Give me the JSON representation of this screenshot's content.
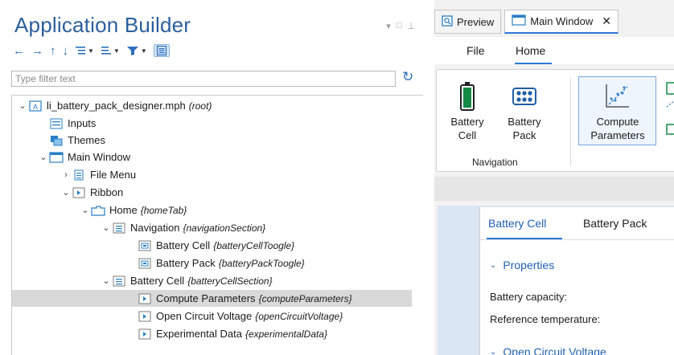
{
  "left_panel": {
    "title": "Application Builder",
    "filter_placeholder": "Type filter text",
    "tree": [
      {
        "label": "li_battery_pack_designer.mph",
        "annotation": "(root)"
      },
      {
        "label": "Inputs",
        "annotation": ""
      },
      {
        "label": "Themes",
        "annotation": ""
      },
      {
        "label": "Main Window",
        "annotation": ""
      },
      {
        "label": "File Menu",
        "annotation": ""
      },
      {
        "label": "Ribbon",
        "annotation": ""
      },
      {
        "label": "Home",
        "annotation": "{homeTab}"
      },
      {
        "label": "Navigation",
        "annotation": "{navigationSection}"
      },
      {
        "label": "Battery Cell",
        "annotation": "{batteryCellToogle}"
      },
      {
        "label": "Battery Pack",
        "annotation": "{batteryPackToogle}"
      },
      {
        "label": "Battery Cell",
        "annotation": "{batteryCellSection}"
      },
      {
        "label": "Compute Parameters",
        "annotation": "{computeParameters}"
      },
      {
        "label": "Open Circuit Voltage",
        "annotation": "{openCircuitVoltage}"
      },
      {
        "label": "Experimental Data",
        "annotation": "{experimentalData}"
      }
    ]
  },
  "right_panel": {
    "tabs": [
      {
        "label": "Preview",
        "icon": "preview-icon"
      },
      {
        "label": "Main Window",
        "icon": "window-icon",
        "close": "✕"
      }
    ],
    "menu": {
      "file": "File",
      "home": "Home"
    },
    "ribbon": {
      "battery_cell": {
        "line1": "Battery",
        "line2": "Cell"
      },
      "battery_pack": {
        "line1": "Battery",
        "line2": "Pack"
      },
      "compute_parameters": {
        "line1": "Compute",
        "line2": "Parameters"
      },
      "section_label": "Navigation"
    },
    "form": {
      "tabs": [
        "Battery Cell",
        "Battery Pack"
      ],
      "section1": "Properties",
      "fields": [
        "Battery capacity:",
        "Reference temperature:"
      ],
      "section2": "Open Circuit Voltage"
    }
  },
  "colors": {
    "title": "#2b5f9e",
    "accent": "#2d7ad6",
    "selected_row": "#d9d9d9",
    "battery_green": "#138a43"
  }
}
